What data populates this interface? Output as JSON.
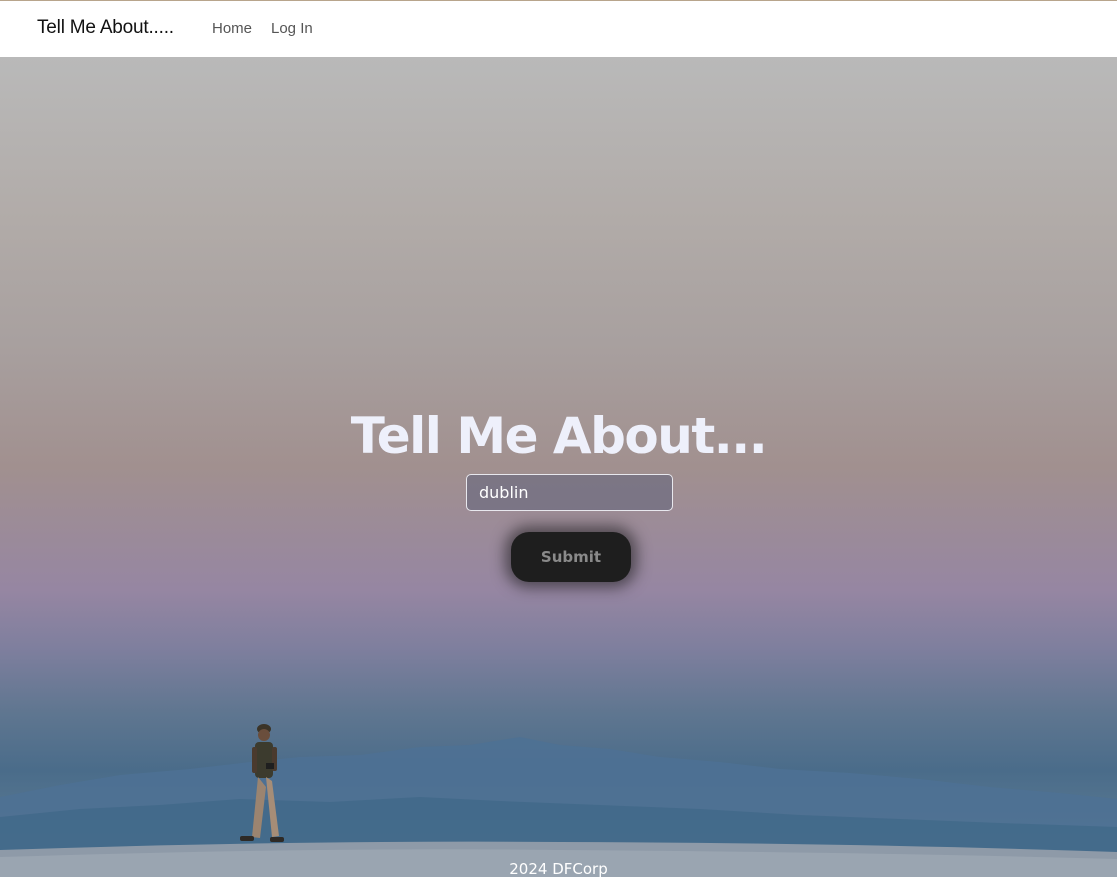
{
  "navbar": {
    "brand": "Tell Me About.....",
    "links": [
      {
        "label": "Home"
      },
      {
        "label": "Log In"
      }
    ]
  },
  "hero": {
    "title": "Tell Me About...",
    "search": {
      "value": "dublin",
      "placeholder": ""
    },
    "submit_label": "Submit"
  },
  "footer": {
    "text": "2024 DFCorp"
  },
  "colors": {
    "navbar_bg": "#ffffff",
    "title": "#eef0fb",
    "button_bg": "#1e1e1e",
    "button_text": "#8a8a8a"
  }
}
